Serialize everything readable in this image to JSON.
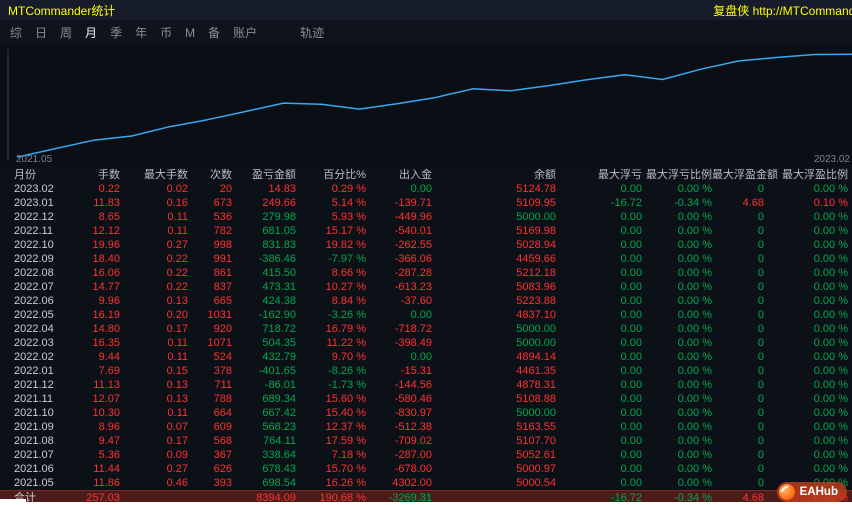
{
  "window": {
    "title": "MTCommander统计",
    "brand": "复盘侠 http://MTCommander",
    "title_color": "#ffff00"
  },
  "tabs": {
    "items": [
      {
        "id": "summary",
        "label": "综",
        "active": false
      },
      {
        "id": "day",
        "label": "日",
        "active": false
      },
      {
        "id": "week",
        "label": "周",
        "active": false
      },
      {
        "id": "month",
        "label": "月",
        "active": true
      },
      {
        "id": "quarter",
        "label": "季",
        "active": false
      },
      {
        "id": "year",
        "label": "年",
        "active": false
      },
      {
        "id": "currency",
        "label": "币",
        "active": false
      },
      {
        "id": "magic",
        "label": "M",
        "active": false
      },
      {
        "id": "note",
        "label": "备",
        "active": false
      },
      {
        "id": "account",
        "label": "账户",
        "active": false
      },
      {
        "id": "trajectory",
        "label": "轨迹",
        "active": false,
        "gap_before": true
      }
    ]
  },
  "chart_data": {
    "type": "line",
    "title": "",
    "xlabel": "",
    "ylabel": "",
    "x": [
      "2021.05",
      "2021.06",
      "2021.07",
      "2021.08",
      "2021.09",
      "2021.10",
      "2021.11",
      "2021.12",
      "2022.01",
      "2022.02",
      "2022.03",
      "2022.04",
      "2022.05",
      "2022.06",
      "2022.07",
      "2022.08",
      "2022.09",
      "2022.10",
      "2022.11",
      "2022.12",
      "2023.01",
      "2023.02"
    ],
    "series": [
      {
        "name": "cumulative-profit",
        "values": [
          698.54,
          1376.97,
          1715.61,
          2479.72,
          3047.95,
          3715.37,
          4404.71,
          4318.7,
          3917.05,
          4349.84,
          4854.19,
          5572.91,
          5410.01,
          5834.39,
          6307.7,
          6723.2,
          6336.74,
          7168.57,
          7849.62,
          8129.6,
          8379.26,
          8394.09
        ]
      }
    ],
    "start_value": 0,
    "x_tick_labels": [
      "2021.05",
      "2023.02"
    ],
    "ylim": [
      0,
      8500
    ],
    "line_color": "#3aa7f0",
    "grid": false,
    "legend": false
  },
  "cell_colors": {
    "r": "#ff3232",
    "g": "#00a94f",
    "w": "#c9ccd2"
  },
  "table": {
    "columns": [
      "月份",
      "手数",
      "最大手数",
      "次数",
      "盈亏金额",
      "百分比%",
      "出入金",
      "余额",
      "最大浮亏",
      "最大浮亏比例",
      "最大浮盈金额",
      "最大浮盈比例"
    ],
    "rows": [
      {
        "cells": [
          "2023.02",
          "0.22",
          "0.02",
          "20",
          "14.83",
          "0.29 %",
          "0.00",
          "5124.78",
          "0.00",
          "0.00 %",
          "0",
          "0.00 %"
        ],
        "colors": [
          "w",
          "r",
          "r",
          "r",
          "r",
          "r",
          "g",
          "r",
          "g",
          "g",
          "g",
          "g"
        ]
      },
      {
        "cells": [
          "2023.01",
          "11.83",
          "0.16",
          "673",
          "249.66",
          "5.14 %",
          "-139.71",
          "5109.95",
          "-16.72",
          "-0.34 %",
          "4.68",
          "0.10 %"
        ],
        "colors": [
          "w",
          "r",
          "r",
          "r",
          "r",
          "r",
          "r",
          "r",
          "g",
          "g",
          "r",
          "r"
        ]
      },
      {
        "cells": [
          "2022.12",
          "8.65",
          "0.11",
          "536",
          "279.98",
          "5.93 %",
          "-449.96",
          "5000.00",
          "0.00",
          "0.00 %",
          "0",
          "0.00 %"
        ],
        "colors": [
          "w",
          "r",
          "r",
          "r",
          "g",
          "r",
          "r",
          "g",
          "g",
          "g",
          "g",
          "g"
        ]
      },
      {
        "cells": [
          "2022.11",
          "12.12",
          "0.11",
          "782",
          "681.05",
          "15.17 %",
          "-540.01",
          "5169.98",
          "0.00",
          "0.00 %",
          "0",
          "0.00 %"
        ],
        "colors": [
          "w",
          "r",
          "r",
          "r",
          "g",
          "r",
          "r",
          "r",
          "g",
          "g",
          "g",
          "g"
        ]
      },
      {
        "cells": [
          "2022.10",
          "19.96",
          "0.27",
          "998",
          "831.83",
          "19.82 %",
          "-262.55",
          "5028.94",
          "0.00",
          "0.00 %",
          "0",
          "0.00 %"
        ],
        "colors": [
          "w",
          "r",
          "r",
          "r",
          "g",
          "r",
          "r",
          "r",
          "g",
          "g",
          "g",
          "g"
        ]
      },
      {
        "cells": [
          "2022.09",
          "18.40",
          "0.22",
          "991",
          "-386.46",
          "-7.97 %",
          "-366.06",
          "4459.66",
          "0.00",
          "0.00 %",
          "0",
          "0.00 %"
        ],
        "colors": [
          "w",
          "r",
          "r",
          "r",
          "g",
          "g",
          "r",
          "r",
          "g",
          "g",
          "g",
          "g"
        ]
      },
      {
        "cells": [
          "2022.08",
          "16.06",
          "0.22",
          "861",
          "415.50",
          "8.66 %",
          "-287.28",
          "5212.18",
          "0.00",
          "0.00 %",
          "0",
          "0.00 %"
        ],
        "colors": [
          "w",
          "r",
          "r",
          "r",
          "g",
          "r",
          "r",
          "r",
          "g",
          "g",
          "g",
          "g"
        ]
      },
      {
        "cells": [
          "2022.07",
          "14.77",
          "0.22",
          "837",
          "473.31",
          "10.27 %",
          "-613.23",
          "5083.96",
          "0.00",
          "0.00 %",
          "0",
          "0.00 %"
        ],
        "colors": [
          "w",
          "r",
          "r",
          "r",
          "g",
          "r",
          "r",
          "r",
          "g",
          "g",
          "g",
          "g"
        ]
      },
      {
        "cells": [
          "2022.06",
          "9.96",
          "0.13",
          "665",
          "424.38",
          "8.84 %",
          "-37.60",
          "5223.88",
          "0.00",
          "0.00 %",
          "0",
          "0.00 %"
        ],
        "colors": [
          "w",
          "r",
          "r",
          "r",
          "g",
          "r",
          "r",
          "r",
          "g",
          "g",
          "g",
          "g"
        ]
      },
      {
        "cells": [
          "2022.05",
          "16.19",
          "0.20",
          "1031",
          "-162.90",
          "-3.26 %",
          "0.00",
          "4837.10",
          "0.00",
          "0.00 %",
          "0",
          "0.00 %"
        ],
        "colors": [
          "w",
          "r",
          "r",
          "r",
          "g",
          "g",
          "g",
          "r",
          "g",
          "g",
          "g",
          "g"
        ]
      },
      {
        "cells": [
          "2022.04",
          "14.80",
          "0.17",
          "920",
          "718.72",
          "16.79 %",
          "-718.72",
          "5000.00",
          "0.00",
          "0.00 %",
          "0",
          "0.00 %"
        ],
        "colors": [
          "w",
          "r",
          "r",
          "r",
          "g",
          "r",
          "r",
          "g",
          "g",
          "g",
          "g",
          "g"
        ]
      },
      {
        "cells": [
          "2022.03",
          "16.35",
          "0.11",
          "1071",
          "504.35",
          "11.22 %",
          "-398.49",
          "5000.00",
          "0.00",
          "0.00 %",
          "0",
          "0.00 %"
        ],
        "colors": [
          "w",
          "r",
          "r",
          "r",
          "g",
          "r",
          "r",
          "g",
          "g",
          "g",
          "g",
          "g"
        ]
      },
      {
        "cells": [
          "2022.02",
          "9.44",
          "0.11",
          "524",
          "432.79",
          "9.70 %",
          "0.00",
          "4894.14",
          "0.00",
          "0.00 %",
          "0",
          "0.00 %"
        ],
        "colors": [
          "w",
          "r",
          "r",
          "r",
          "g",
          "r",
          "g",
          "r",
          "g",
          "g",
          "g",
          "g"
        ]
      },
      {
        "cells": [
          "2022.01",
          "7.69",
          "0.15",
          "378",
          "-401.65",
          "-8.26 %",
          "-15.31",
          "4461.35",
          "0.00",
          "0.00 %",
          "0",
          "0.00 %"
        ],
        "colors": [
          "w",
          "r",
          "r",
          "r",
          "g",
          "g",
          "r",
          "r",
          "g",
          "g",
          "g",
          "g"
        ]
      },
      {
        "cells": [
          "2021.12",
          "11.13",
          "0.13",
          "711",
          "-86.01",
          "-1.73 %",
          "-144.56",
          "4878.31",
          "0.00",
          "0.00 %",
          "0",
          "0.00 %"
        ],
        "colors": [
          "w",
          "r",
          "r",
          "r",
          "g",
          "g",
          "r",
          "r",
          "g",
          "g",
          "g",
          "g"
        ]
      },
      {
        "cells": [
          "2021.11",
          "12.07",
          "0.13",
          "788",
          "689.34",
          "15.60 %",
          "-580.46",
          "5108.88",
          "0.00",
          "0.00 %",
          "0",
          "0.00 %"
        ],
        "colors": [
          "w",
          "r",
          "r",
          "r",
          "g",
          "r",
          "r",
          "r",
          "g",
          "g",
          "g",
          "g"
        ]
      },
      {
        "cells": [
          "2021.10",
          "10.30",
          "0.11",
          "664",
          "667.42",
          "15.40 %",
          "-830.97",
          "5000.00",
          "0.00",
          "0.00 %",
          "0",
          "0.00 %"
        ],
        "colors": [
          "w",
          "r",
          "r",
          "r",
          "g",
          "r",
          "r",
          "g",
          "g",
          "g",
          "g",
          "g"
        ]
      },
      {
        "cells": [
          "2021.09",
          "8.96",
          "0.07",
          "609",
          "568.23",
          "12.37 %",
          "-512.38",
          "5163.55",
          "0.00",
          "0.00 %",
          "0",
          "0.00 %"
        ],
        "colors": [
          "w",
          "r",
          "r",
          "r",
          "g",
          "r",
          "r",
          "r",
          "g",
          "g",
          "g",
          "g"
        ]
      },
      {
        "cells": [
          "2021.08",
          "9.47",
          "0.17",
          "568",
          "764.11",
          "17.59 %",
          "-709.02",
          "5107.70",
          "0.00",
          "0.00 %",
          "0",
          "0.00 %"
        ],
        "colors": [
          "w",
          "r",
          "r",
          "r",
          "g",
          "r",
          "r",
          "r",
          "g",
          "g",
          "g",
          "g"
        ]
      },
      {
        "cells": [
          "2021.07",
          "5.36",
          "0.09",
          "367",
          "338.64",
          "7.18 %",
          "-287.00",
          "5052.61",
          "0.00",
          "0.00 %",
          "0",
          "0.00 %"
        ],
        "colors": [
          "w",
          "r",
          "r",
          "r",
          "g",
          "r",
          "r",
          "r",
          "g",
          "g",
          "g",
          "g"
        ]
      },
      {
        "cells": [
          "2021.06",
          "11.44",
          "0.27",
          "626",
          "678.43",
          "15.70 %",
          "-678.00",
          "5000.97",
          "0.00",
          "0.00 %",
          "0",
          "0.00 %"
        ],
        "colors": [
          "w",
          "r",
          "r",
          "r",
          "g",
          "r",
          "r",
          "r",
          "g",
          "g",
          "g",
          "g"
        ]
      },
      {
        "cells": [
          "2021.05",
          "11.86",
          "0.46",
          "393",
          "698.54",
          "16.26 %",
          "4302.00",
          "5000.54",
          "0.00",
          "0.00 %",
          "0",
          "0.00 %"
        ],
        "colors": [
          "w",
          "r",
          "r",
          "r",
          "g",
          "r",
          "r",
          "r",
          "g",
          "g",
          "g",
          "g"
        ]
      }
    ],
    "total": {
      "cells": [
        "合计",
        "257.03",
        "",
        "",
        "8394.09",
        "190.68 %",
        "-3269.31",
        "",
        "-16.72",
        "-0.34 %",
        "4.68",
        "0.10 %"
      ],
      "colors": [
        "w",
        "r",
        "",
        "",
        "r",
        "r",
        "g",
        "",
        "g",
        "g",
        "r",
        "r"
      ]
    }
  },
  "watermark": {
    "text": "EAHub",
    "accent": "#ff7316"
  }
}
